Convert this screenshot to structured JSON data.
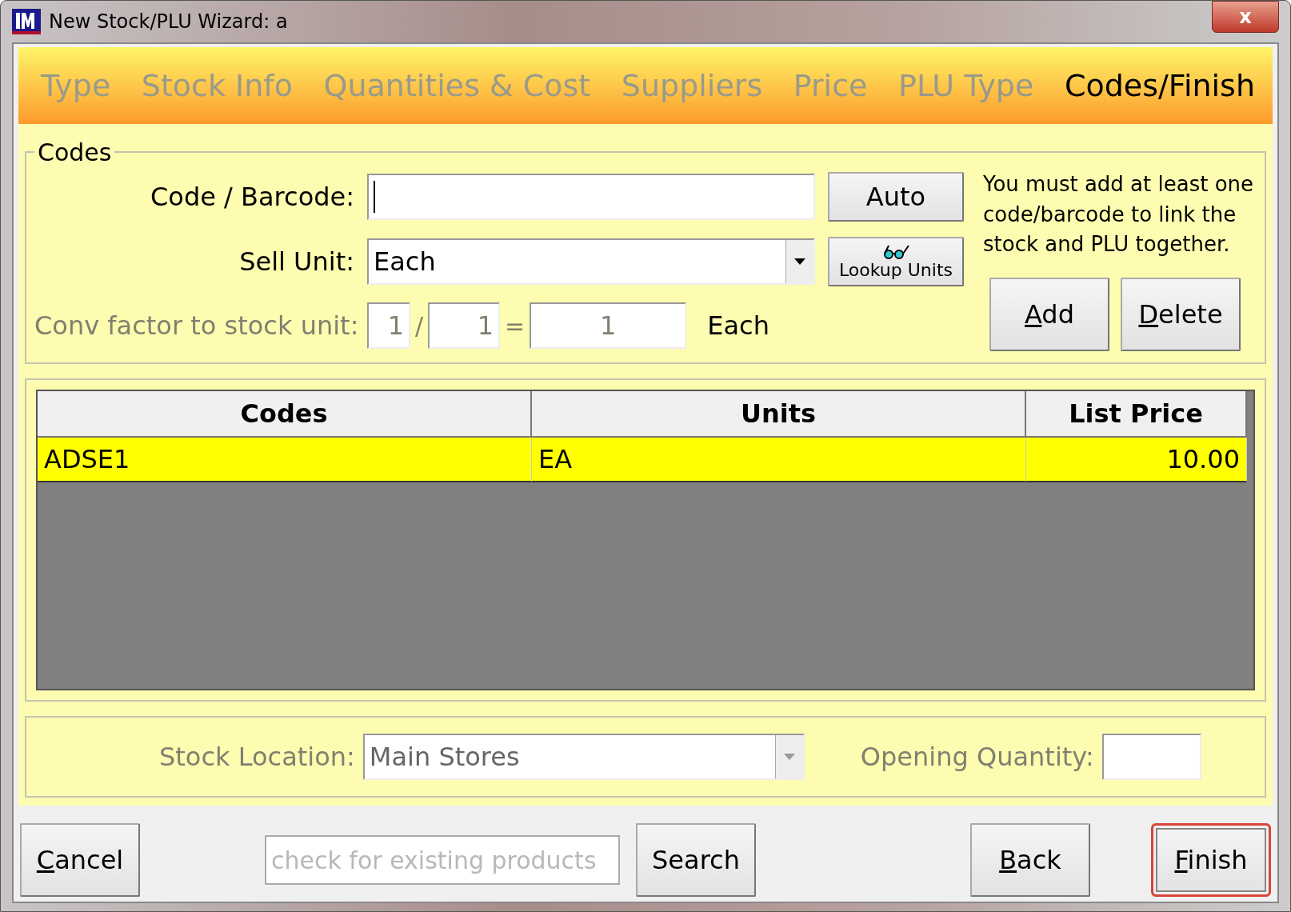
{
  "window": {
    "title": "New Stock/PLU Wizard: a",
    "close": "x"
  },
  "tabs": [
    {
      "label": "Type",
      "selected": false
    },
    {
      "label": "Stock Info",
      "selected": false
    },
    {
      "label": "Quantities & Cost",
      "selected": false
    },
    {
      "label": "Suppliers",
      "selected": false
    },
    {
      "label": "Price",
      "selected": false
    },
    {
      "label": "PLU Type",
      "selected": false
    },
    {
      "label": "Codes/Finish",
      "selected": true
    }
  ],
  "codes": {
    "title": "Codes",
    "code_label": "Code / Barcode:",
    "auto_button": "Auto",
    "sell_unit_label": "Sell Unit:",
    "sell_unit": "Each",
    "lookup_button": "Lookup Units",
    "conv_label": "Conv factor to stock unit:",
    "conv_disabled": true,
    "conv_a": "1",
    "slash": "/",
    "conv_b": "1",
    "equals": "=",
    "conv_result": "1",
    "conv_unit": "Each",
    "hint": "You must add at least one code/barcode to link the stock and PLU together.",
    "buttons": [
      {
        "label": "Add",
        "underline_first": true
      },
      {
        "label": "Delete",
        "underline_first": true
      }
    ]
  },
  "table": {
    "columns": [
      "Codes",
      "Units",
      "List Price"
    ],
    "rows": [
      {
        "cells": [
          "ADSE1",
          "EA",
          "10.00"
        ],
        "selected": true
      }
    ]
  },
  "location": {
    "label": "Stock Location:",
    "value": "Main Stores",
    "disabled": true,
    "quantity_label": "Opening Quantity:"
  },
  "footer": {
    "cancel": {
      "label": "Cancel",
      "underline_first": true
    },
    "search_placeholder": "check for existing products",
    "search": {
      "label": "Search",
      "underline_first": false
    },
    "back": {
      "label": "Back",
      "underline_first": true
    },
    "finish": {
      "label": "Finish",
      "underline_first": true,
      "focused": true
    }
  }
}
